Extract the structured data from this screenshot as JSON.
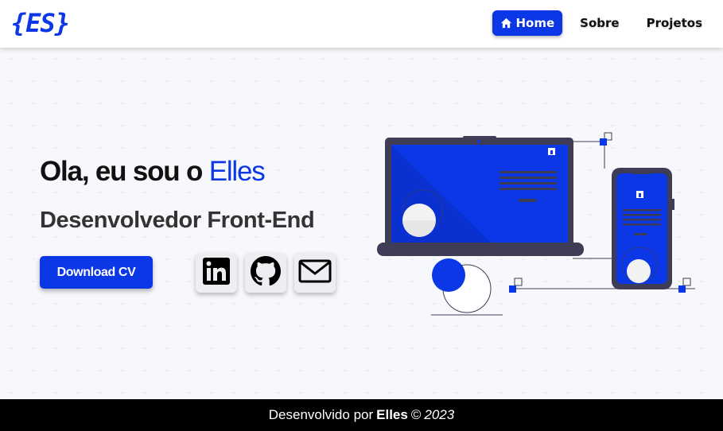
{
  "logo": {
    "text": "{ES}"
  },
  "nav": {
    "items": [
      {
        "label": "Home",
        "icon": "home-icon",
        "active": true
      },
      {
        "label": "Sobre",
        "active": false
      },
      {
        "label": "Projetos",
        "active": false
      }
    ]
  },
  "hero": {
    "greeting": "Ola, eu sou o",
    "name": "Elles",
    "subtitle": "Desenvolvedor Front-End",
    "cv_button": "Download CV",
    "socials": [
      {
        "icon": "linkedin-icon"
      },
      {
        "icon": "github-icon"
      },
      {
        "icon": "mail-icon"
      }
    ]
  },
  "footer": {
    "prefix": "Desenvolvido por",
    "author": "Elles",
    "copyright": "©",
    "year": "2023"
  },
  "colors": {
    "accent": "#0b37e6",
    "dark_device": "#3f3d56",
    "footer_bg": "#000000"
  }
}
